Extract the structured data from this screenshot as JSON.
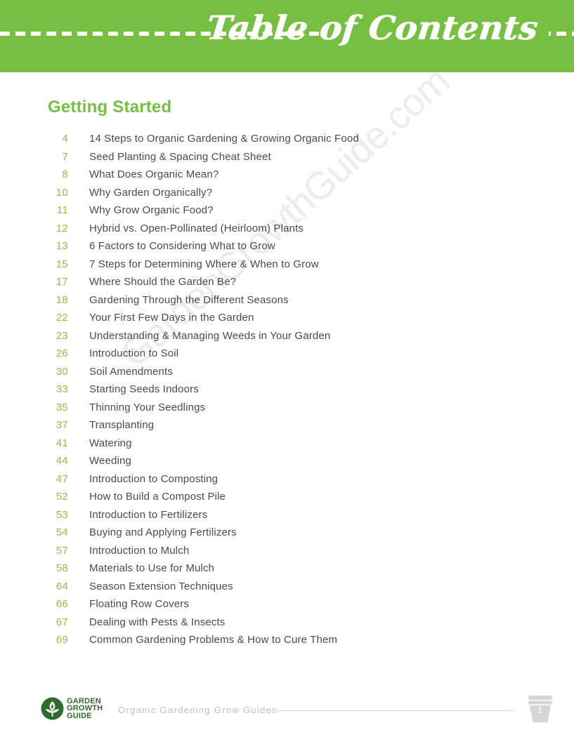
{
  "header": {
    "title": "Table of Contents",
    "background_color": "#76bf43",
    "dash_color": "#ffffff"
  },
  "watermark": {
    "text": "GardenGrowthGuide.com",
    "color": "#ececec"
  },
  "section": {
    "title": "Getting Started",
    "title_color": "#76bf43"
  },
  "toc": {
    "page_number_color": "#8bc34a",
    "title_color": "#4a4a4a",
    "entries": [
      {
        "page": "4",
        "title": "14 Steps to Organic Gardening & Growing Organic Food"
      },
      {
        "page": "7",
        "title": "Seed Planting & Spacing Cheat Sheet"
      },
      {
        "page": "8",
        "title": "What Does Organic Mean?"
      },
      {
        "page": "10",
        "title": "Why Garden Organically?"
      },
      {
        "page": "11",
        "title": "Why Grow Organic Food?"
      },
      {
        "page": "12",
        "title": "Hybrid vs. Open-Pollinated (Heirloom) Plants"
      },
      {
        "page": "13",
        "title": "6 Factors to Considering What to Grow"
      },
      {
        "page": "15",
        "title": "7 Steps for Determining Where & When to Grow"
      },
      {
        "page": "17",
        "title": "Where Should the Garden Be?"
      },
      {
        "page": "18",
        "title": "Gardening Through the Different Seasons"
      },
      {
        "page": "22",
        "title": "Your First Few Days in the Garden"
      },
      {
        "page": "23",
        "title": "Understanding & Managing Weeds in Your Garden"
      },
      {
        "page": "26",
        "title": "Introduction to Soil"
      },
      {
        "page": "30",
        "title": "Soil Amendments"
      },
      {
        "page": "33",
        "title": "Starting Seeds Indoors"
      },
      {
        "page": "35",
        "title": "Thinning Your Seedlings"
      },
      {
        "page": "37",
        "title": "Transplanting"
      },
      {
        "page": "41",
        "title": "Watering"
      },
      {
        "page": "44",
        "title": "Weeding"
      },
      {
        "page": "47",
        "title": "Introduction to Composting"
      },
      {
        "page": "52",
        "title": "How to Build a Compost Pile"
      },
      {
        "page": "53",
        "title": "Introduction to Fertilizers"
      },
      {
        "page": "54",
        "title": "Buying and Applying Fertilizers"
      },
      {
        "page": "57",
        "title": "Introduction to Mulch"
      },
      {
        "page": "58",
        "title": "Materials to Use for Mulch"
      },
      {
        "page": "64",
        "title": "Season Extension Techniques"
      },
      {
        "page": "66",
        "title": "Floating Row Covers"
      },
      {
        "page": "67",
        "title": "Dealing with Pests & Insects"
      },
      {
        "page": "69",
        "title": "Common Gardening Problems & How to Cure Them"
      }
    ]
  },
  "footer": {
    "logo": {
      "line1": "GARDEN",
      "line2": "GROWTH",
      "line3": "GUIDE",
      "color": "#2f6b2b"
    },
    "tagline": "Organic Gardening Grow Guides",
    "page_number": "1"
  }
}
